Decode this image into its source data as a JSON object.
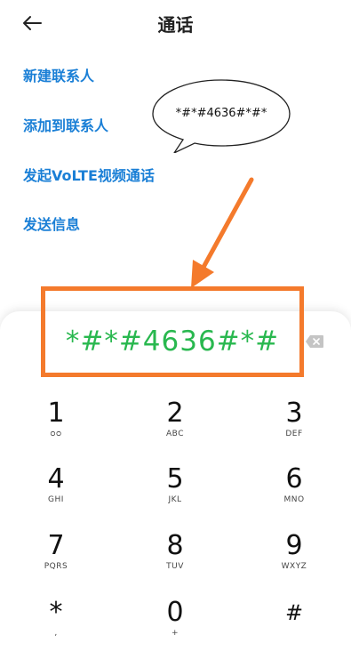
{
  "header": {
    "title": "通话"
  },
  "menu": [
    {
      "label": "新建联系人"
    },
    {
      "label": "添加到联系人"
    },
    {
      "label": "发起VoLTE视频通话"
    },
    {
      "label": "发送信息"
    }
  ],
  "bubble": {
    "text": "*#*#4636#*#*"
  },
  "dialer": {
    "number": "*#*#4636#*#",
    "keys": [
      {
        "digit": "1",
        "letters": "ᴑᴑ"
      },
      {
        "digit": "2",
        "letters": "ABC"
      },
      {
        "digit": "3",
        "letters": "DEF"
      },
      {
        "digit": "4",
        "letters": "GHI"
      },
      {
        "digit": "5",
        "letters": "JKL"
      },
      {
        "digit": "6",
        "letters": "MNO"
      },
      {
        "digit": "7",
        "letters": "PQRS"
      },
      {
        "digit": "8",
        "letters": "TUV"
      },
      {
        "digit": "9",
        "letters": "WXYZ"
      },
      {
        "digit": "*",
        "letters": ","
      },
      {
        "digit": "0",
        "letters": "+"
      },
      {
        "digit": "#",
        "letters": ""
      }
    ]
  },
  "colors": {
    "accent_blue": "#1a7fd6",
    "highlight_orange": "#f47a2c",
    "number_green": "#29b84f"
  }
}
